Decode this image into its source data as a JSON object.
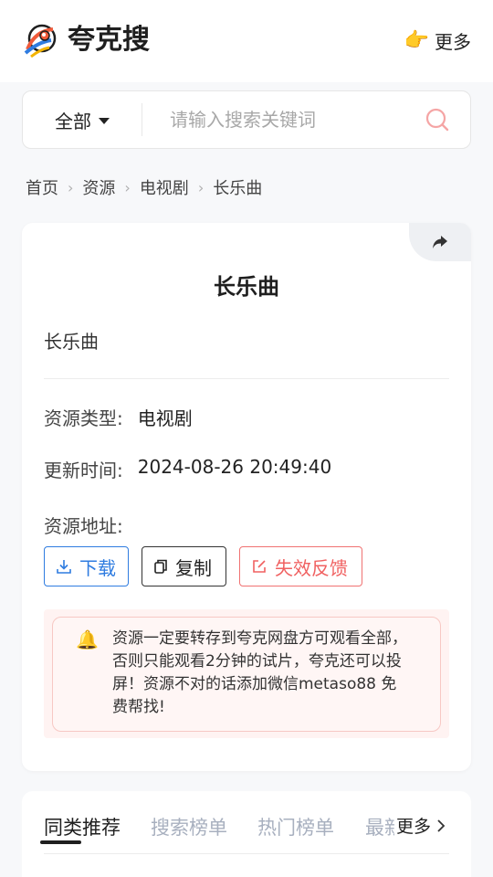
{
  "header": {
    "site_name": "夸克搜",
    "more_label": "更多",
    "more_emoji": "👉"
  },
  "search": {
    "scope": "全部",
    "placeholder": "请输入搜索关键词",
    "accent": "#f5a5a5"
  },
  "breadcrumb": [
    "首页",
    "资源",
    "电视剧",
    "长乐曲"
  ],
  "resource": {
    "title": "长乐曲",
    "subtitle": "长乐曲",
    "type_label": "资源类型:",
    "type_value": "电视剧",
    "time_label": "更新时间:",
    "time_value": "2024-08-26 20:49:40",
    "address_label": "资源地址:"
  },
  "actions": {
    "download": "下载",
    "copy": "复制",
    "report": "失效反馈"
  },
  "notice": {
    "icon": "bell-icon",
    "text": "资源一定要转存到夸克网盘方可观看全部，否则只能观看2分钟的试片，夸克还可以投屏！资源不对的话添加微信metaso88 免费帮找!"
  },
  "tabs": {
    "items": [
      "同类推荐",
      "搜索榜单",
      "热门榜单",
      "最新"
    ],
    "more_label": "更多"
  },
  "colors": {
    "primary_blue": "#2f7ce0",
    "danger_red": "#f06060",
    "inactive_tab": "#a8b0bf"
  }
}
